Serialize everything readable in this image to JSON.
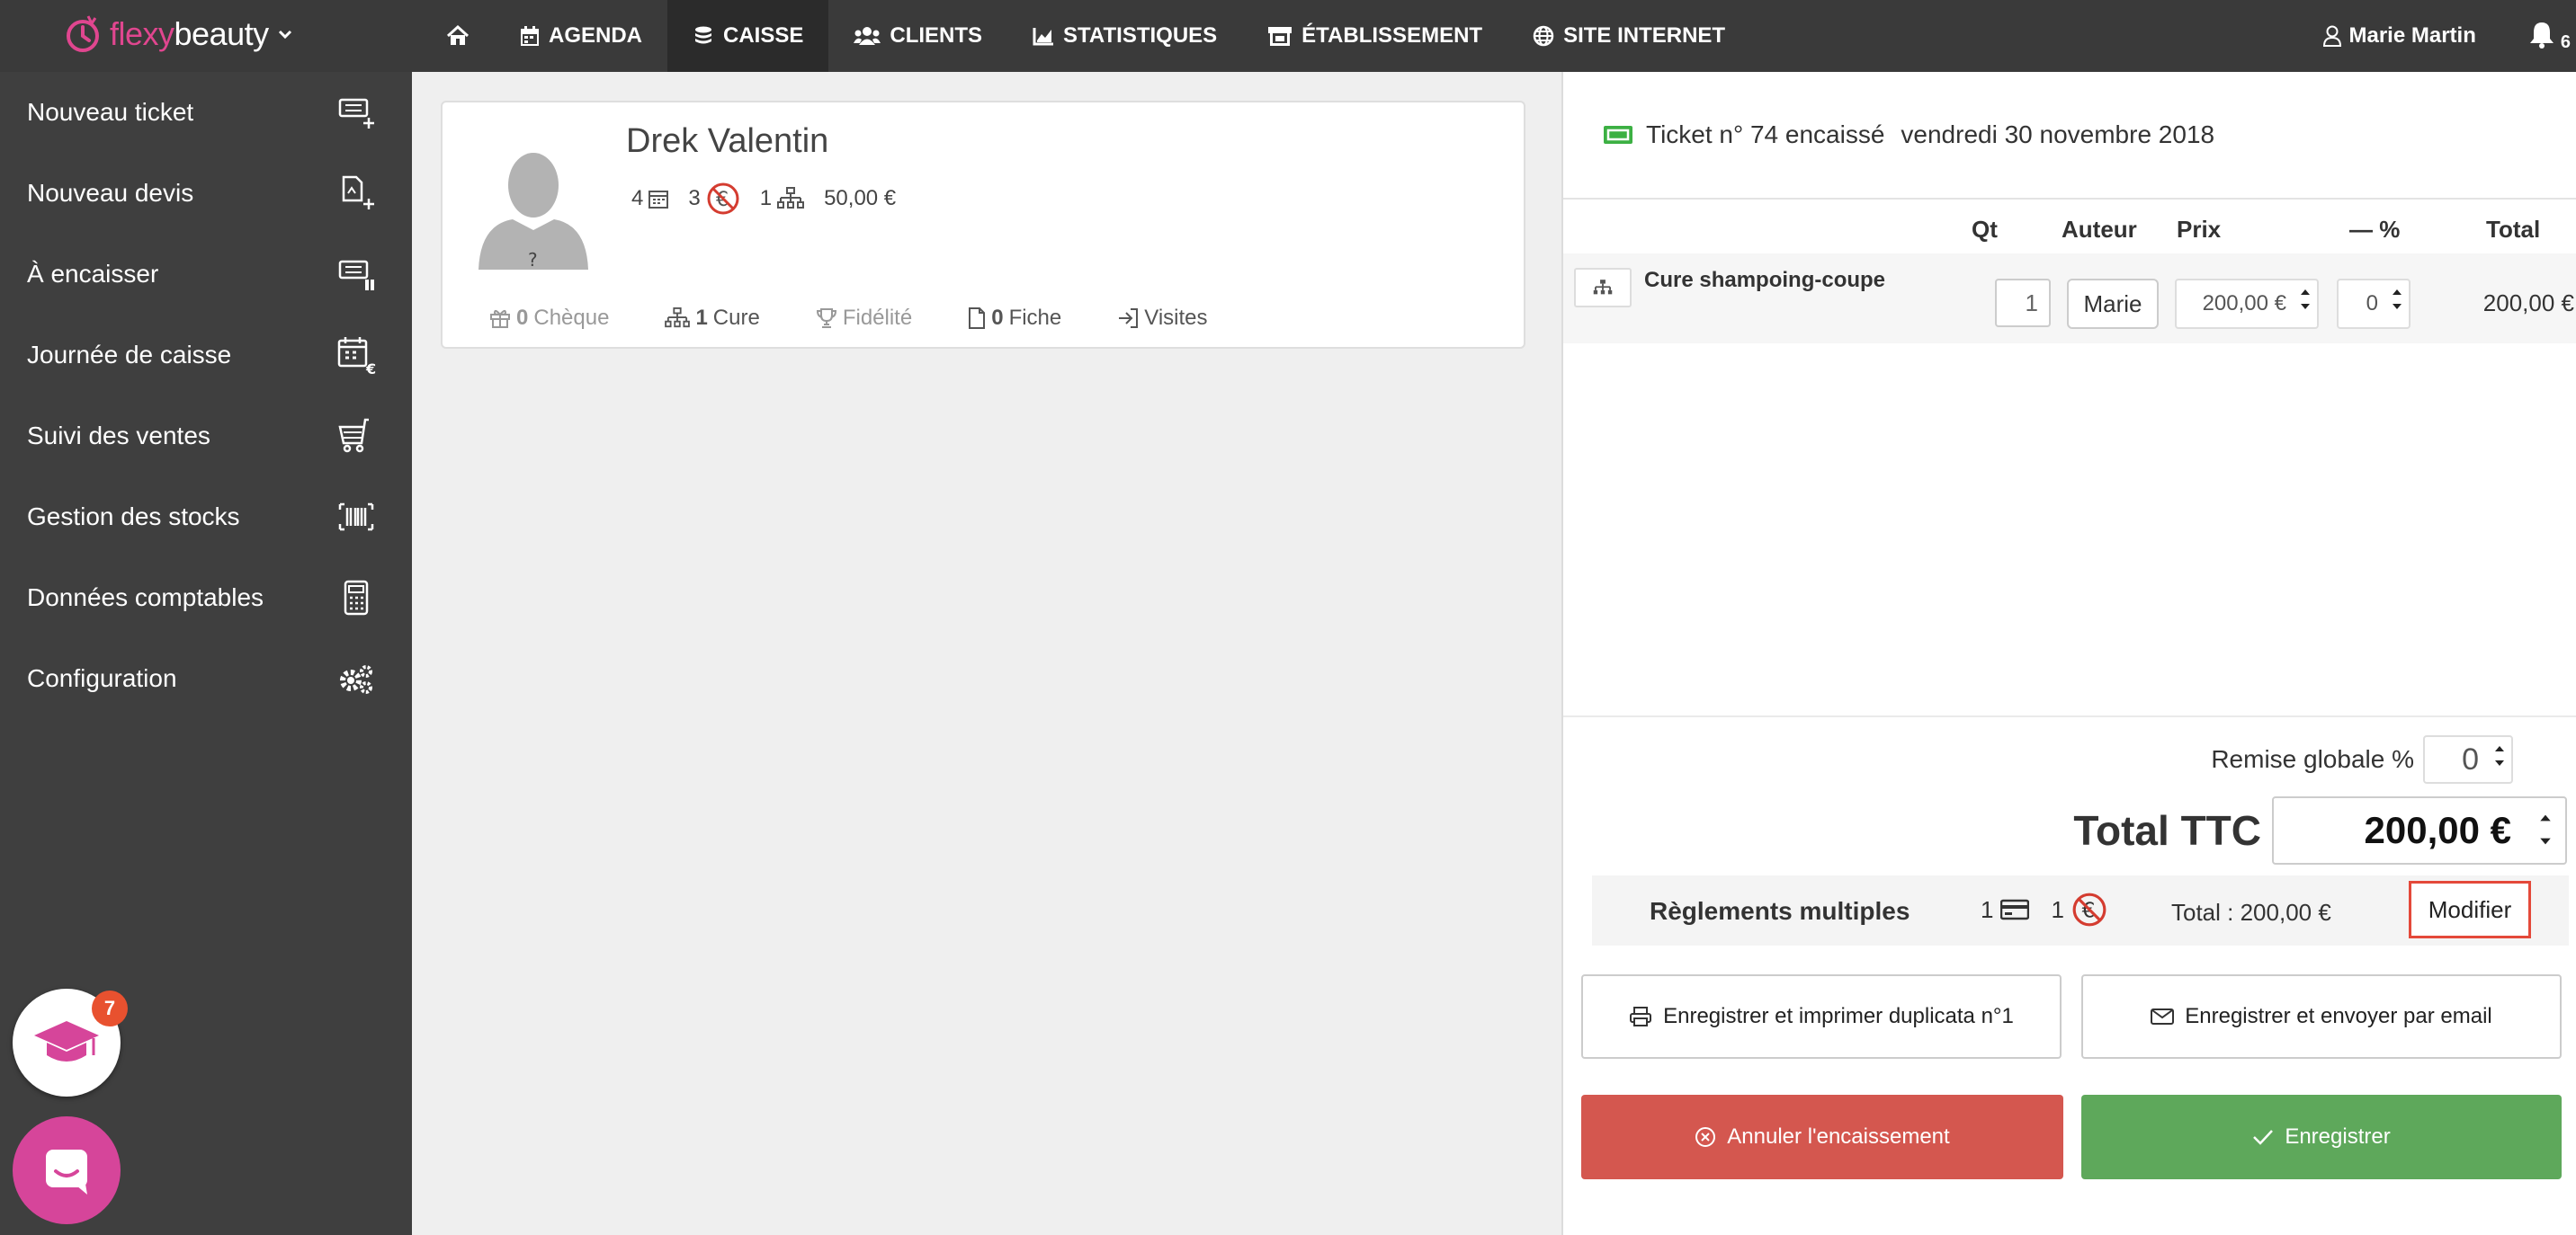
{
  "brand": {
    "part1": "flexy",
    "part2": "beauty"
  },
  "nav": {
    "items": [
      {
        "label": "",
        "icon": "home-icon"
      },
      {
        "label": "AGENDA",
        "icon": "calendar-icon"
      },
      {
        "label": "CAISSE",
        "icon": "coins-icon",
        "active": true
      },
      {
        "label": "CLIENTS",
        "icon": "users-icon"
      },
      {
        "label": "STATISTIQUES",
        "icon": "chart-icon"
      },
      {
        "label": "ÉTABLISSEMENT",
        "icon": "store-icon"
      },
      {
        "label": "SITE INTERNET",
        "icon": "globe-icon"
      }
    ],
    "user": "Marie Martin",
    "notifications": "6"
  },
  "sidebar": {
    "items": [
      {
        "label": "Nouveau ticket"
      },
      {
        "label": "Nouveau devis"
      },
      {
        "label": "À encaisser"
      },
      {
        "label": "Journée de caisse"
      },
      {
        "label": "Suivi des ventes"
      },
      {
        "label": "Gestion des stocks"
      },
      {
        "label": "Données comptables"
      },
      {
        "label": "Configuration"
      }
    ],
    "edu_badge": "7"
  },
  "client": {
    "name": "Drek Valentin",
    "avatar_mark": "?",
    "stats": {
      "appointments": "4",
      "unpaid": "3",
      "cures": "1",
      "amount": "50,00 €"
    },
    "tabs": [
      {
        "num": "0",
        "label": "Chèque"
      },
      {
        "num": "1",
        "label": "Cure"
      },
      {
        "num": "",
        "label": "Fidélité"
      },
      {
        "num": "0",
        "label": "Fiche"
      },
      {
        "num": "",
        "label": "Visites"
      }
    ]
  },
  "ticket": {
    "title": "Ticket n° 74 encaissé",
    "date": "vendredi 30 novembre 2018",
    "headers": {
      "qty": "Qt",
      "author": "Auteur",
      "price": "Prix",
      "discount": "— %",
      "total": "Total"
    },
    "line": {
      "label": "Cure shampoing-coupe",
      "qty": "1",
      "author": "Marie",
      "price": "200,00 €",
      "discount": "0",
      "total": "200,00 €"
    },
    "remise_label": "Remise globale %",
    "remise_value": "0",
    "total_label": "Total TTC",
    "total_value": "200,00 €",
    "reglements": {
      "title": "Règlements multiples",
      "card_count": "1",
      "cash_count": "1",
      "total": "Total : 200,00 €",
      "modifier": "Modifier"
    },
    "buttons": {
      "print": "Enregistrer et imprimer duplicata n°1",
      "email": "Enregistrer et envoyer par email",
      "cancel": "Annuler l'encaissement",
      "save": "Enregistrer"
    }
  },
  "colors": {
    "accent": "#e0468f",
    "danger": "#d4574f",
    "success": "#5ea85b",
    "ticket_ok": "#3cb043"
  }
}
